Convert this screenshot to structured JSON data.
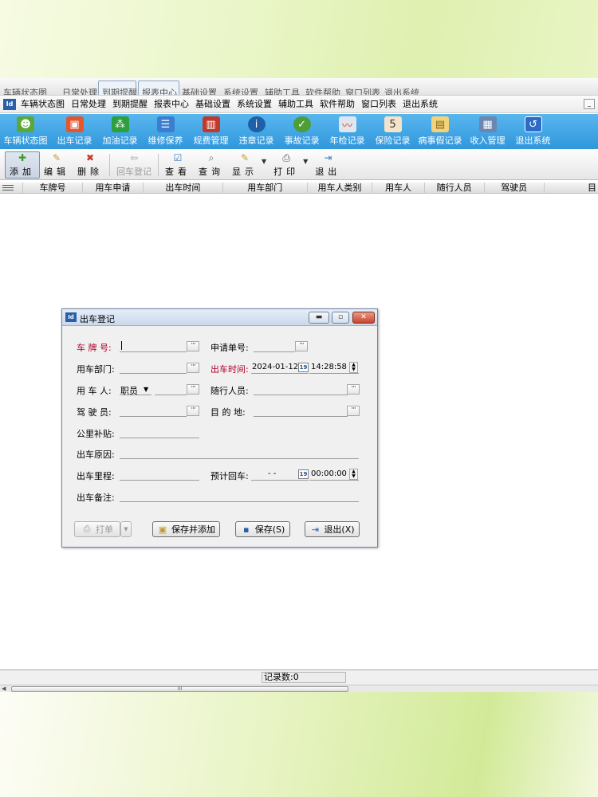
{
  "ghost_tabs": [
    "车辆状态图",
    "日常处理",
    "到期提醒",
    "报表中心",
    "基础设置",
    "系统设置",
    "辅助工具",
    "软件帮助",
    "窗口列表",
    "退出系统"
  ],
  "menu": [
    "车辆状态图",
    "日常处理",
    "到期提醒",
    "报表中心",
    "基础设置",
    "系统设置",
    "辅助工具",
    "软件帮助",
    "窗口列表",
    "退出系统"
  ],
  "big_toolbar": [
    {
      "label": "车辆状态图",
      "icon": "users-icon",
      "color": "#5aa83a"
    },
    {
      "label": "出车记录",
      "icon": "vehicle-out-icon",
      "color": "#e4572e"
    },
    {
      "label": "加油记录",
      "icon": "fuel-icon",
      "color": "#2e9e3e"
    },
    {
      "label": "维修保养",
      "icon": "repair-icon",
      "color": "#3b7ed0"
    },
    {
      "label": "规费管理",
      "icon": "fees-icon",
      "color": "#c0392b"
    },
    {
      "label": "违章记录",
      "icon": "violation-icon",
      "color": "#1f5fa8"
    },
    {
      "label": "事故记录",
      "icon": "accident-icon",
      "color": "#4c9e35"
    },
    {
      "label": "年检记录",
      "icon": "inspection-icon",
      "color": "#8aa0b8"
    },
    {
      "label": "保险记录",
      "icon": "insurance-icon",
      "color": "#c0392b"
    },
    {
      "label": "病事假记录",
      "icon": "leave-icon",
      "color": "#e0b84a"
    },
    {
      "label": "收入管理",
      "icon": "income-icon",
      "color": "#6b86b0"
    },
    {
      "label": "退出系统",
      "icon": "exit-system-icon",
      "color": "#2d6bc9"
    }
  ],
  "toolbar": {
    "add": "添加",
    "edit": "编辑",
    "delete": "删除",
    "return": "回车登记",
    "view": "查看",
    "query": "查询",
    "display": "显示",
    "print": "打印",
    "exit": "退出"
  },
  "grid": {
    "columns": [
      "车牌号",
      "用车申请",
      "出车时间",
      "用车部门",
      "用车人类别",
      "用车人",
      "随行人员",
      "驾驶员",
      "目"
    ]
  },
  "status": {
    "record_count": "记录数:0",
    "scroll_grip": "III"
  },
  "dialog": {
    "title": "出车登记",
    "fields": {
      "plate": "车 牌 号:",
      "request_no": "申请单号:",
      "department": "用车部门:",
      "depart_time": "出车时间:",
      "depart_date_value": "2024-01-12",
      "depart_time_value": "14:28:58",
      "user": "用 车 人:",
      "user_type_value": "职员",
      "companions": "随行人员:",
      "driver": "驾 驶 员:",
      "destination": "目 的 地:",
      "mileage_allowance": "公里补贴:",
      "reason": "出车原因:",
      "mileage": "出车里程:",
      "expected_return": "预计回车:",
      "return_date_value": "- -",
      "return_time_value": "00:00:00",
      "remarks": "出车备注:"
    },
    "buttons": {
      "print": "打单",
      "save_add": "保存并添加",
      "save": "保存(S)",
      "exit": "退出(X)"
    }
  }
}
